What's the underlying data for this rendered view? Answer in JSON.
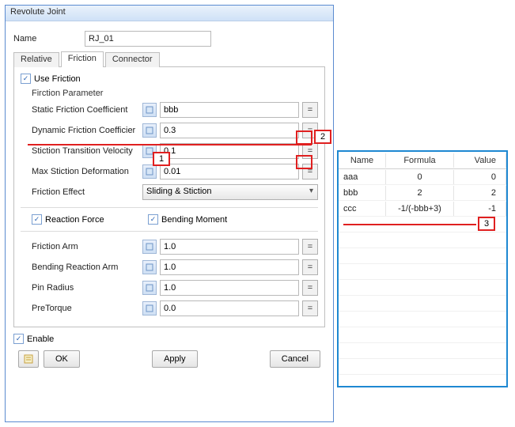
{
  "window": {
    "title": "Revolute Joint"
  },
  "name": {
    "label": "Name",
    "value": "RJ_01"
  },
  "tabs": {
    "relative": "Relative",
    "friction": "Friction",
    "connector": "Connector"
  },
  "friction": {
    "use_friction": "Use Friction",
    "param_title": "Firction Parameter",
    "static": {
      "label": "Static Friction Coefficient",
      "value": "bbb"
    },
    "dynamic": {
      "label": "Dynamic Friction Coefficier",
      "value": "0.3"
    },
    "stiction_vel": {
      "label": "Stiction Transition Velocity",
      "value": "0.1"
    },
    "max_def": {
      "label": "Max Stiction Deformation",
      "value": "0.01"
    },
    "effect": {
      "label": "Friction Effect",
      "value": "Sliding & Stiction"
    },
    "reaction_force": "Reaction Force",
    "bending_moment": "Bending Moment",
    "friction_arm": {
      "label": "Friction Arm",
      "value": "1.0"
    },
    "bending_arm": {
      "label": "Bending Reaction Arm",
      "value": "1.0"
    },
    "pin_radius": {
      "label": "Pin Radius",
      "value": "1.0"
    },
    "pretorque": {
      "label": "PreTorque",
      "value": "0.0"
    }
  },
  "footer": {
    "enable": "Enable",
    "ok": "OK",
    "apply": "Apply",
    "cancel": "Cancel"
  },
  "callouts": {
    "one": "1",
    "two": "2",
    "three": "3"
  },
  "table": {
    "headers": {
      "name": "Name",
      "formula": "Formula",
      "value": "Value"
    },
    "rows": [
      {
        "name": "aaa",
        "formula": "0",
        "value": "0"
      },
      {
        "name": "bbb",
        "formula": "2",
        "value": "2"
      },
      {
        "name": "ccc",
        "formula": "-1/(-bbb+3)",
        "value": "-1"
      }
    ]
  }
}
